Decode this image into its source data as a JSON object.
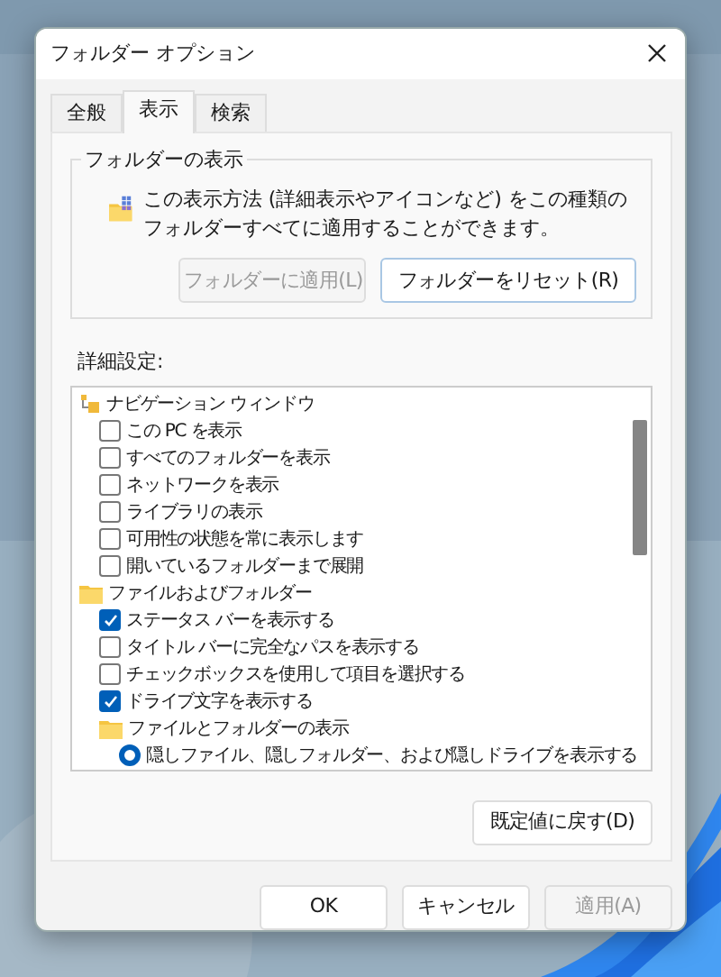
{
  "window": {
    "title": "フォルダー オプション"
  },
  "tabs": [
    {
      "label": "全般",
      "selected": false
    },
    {
      "label": "表示",
      "selected": true
    },
    {
      "label": "検索",
      "selected": false
    }
  ],
  "folder_views": {
    "title": "フォルダーの表示",
    "description": "この表示方法 (詳細表示やアイコンなど) をこの種類のフォルダーすべてに適用することができます。",
    "buttons": [
      {
        "label": "フォルダーに適用(L)",
        "disabled": true
      },
      {
        "label": "フォルダーをリセット(R)",
        "disabled": false
      }
    ]
  },
  "advanced": {
    "label": "詳細設定:",
    "items": [
      {
        "kind": "pane",
        "label": "ナビゲーション ウィンドウ",
        "children": [
          {
            "kind": "checkbox",
            "label": "この PC を表示",
            "checked": false
          },
          {
            "kind": "checkbox",
            "label": "すべてのフォルダーを表示",
            "checked": false
          },
          {
            "kind": "checkbox",
            "label": "ネットワークを表示",
            "checked": false
          },
          {
            "kind": "checkbox",
            "label": "ライブラリの表示",
            "checked": false
          },
          {
            "kind": "checkbox",
            "label": "可用性の状態を常に表示します",
            "checked": false
          },
          {
            "kind": "checkbox",
            "label": "開いているフォルダーまで展開",
            "checked": false
          }
        ]
      },
      {
        "kind": "folder",
        "label": "ファイルおよびフォルダー",
        "children": [
          {
            "kind": "checkbox",
            "label": "ステータス バーを表示する",
            "checked": true
          },
          {
            "kind": "checkbox",
            "label": "タイトル バーに完全なパスを表示する",
            "checked": false
          },
          {
            "kind": "checkbox",
            "label": "チェックボックスを使用して項目を選択する",
            "checked": false
          },
          {
            "kind": "checkbox",
            "label": "ドライブ文字を表示する",
            "checked": true
          },
          {
            "kind": "folder",
            "label": "ファイルとフォルダーの表示",
            "children": [
              {
                "kind": "radio",
                "label": "隠しファイル、隠しフォルダー、および隠しドライブを表示する",
                "selected": true
              }
            ]
          }
        ]
      }
    ]
  },
  "restore_button": {
    "label": "既定値に戻す(D)"
  },
  "footer_buttons": [
    {
      "label": "OK",
      "disabled": false
    },
    {
      "label": "キャンセル",
      "disabled": false
    },
    {
      "label": "適用(A)",
      "disabled": true
    }
  ]
}
